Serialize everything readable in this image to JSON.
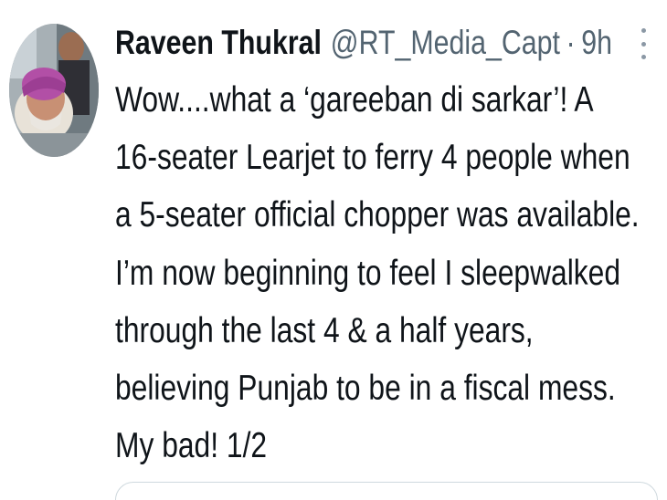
{
  "tweet": {
    "display_name": "Raveen Thukral",
    "handle": "@RT_Media_Capt",
    "separator": "·",
    "time": "9h",
    "text_lines": [
      "Wow....what a ‘gareeban di sarkar’! A",
      "16-seater Learjet to ferry 4 people when",
      "a 5-seater official chopper was available.",
      "I’m now beginning to feel I sleepwalked",
      "through the last 4 & a half years,",
      "believing Punjab to be in a fiscal mess.",
      "My bad! 1/2"
    ],
    "avatar_icon": "profile-photo",
    "more_icon": "more-vertical-icon"
  },
  "colors": {
    "text": "#0f1419",
    "secondary": "#536471",
    "border": "#cfd9de"
  }
}
